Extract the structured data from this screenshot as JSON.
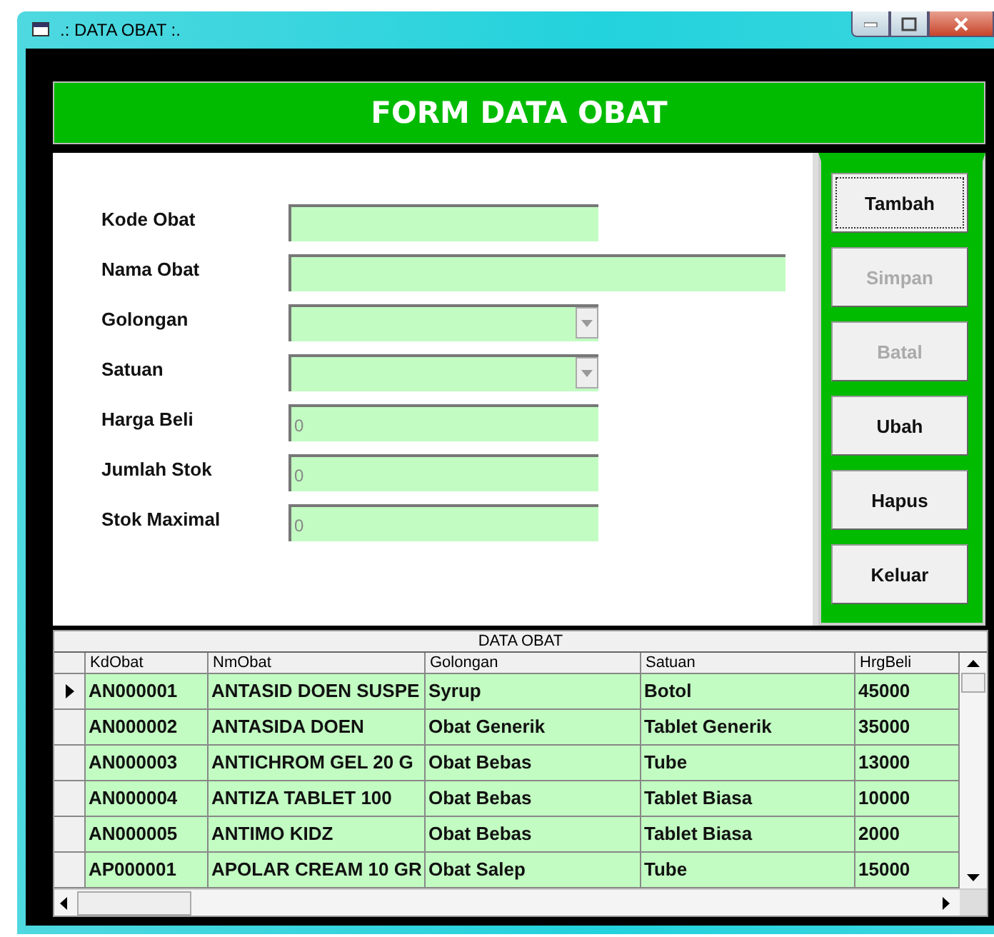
{
  "window": {
    "title": ".: DATA OBAT :."
  },
  "header": {
    "title": "FORM DATA OBAT"
  },
  "fields": [
    {
      "label": "Kode Obat",
      "kind": "text",
      "wide": false
    },
    {
      "label": "Nama Obat",
      "kind": "text",
      "wide": true
    },
    {
      "label": "Golongan",
      "kind": "combo",
      "wide": false
    },
    {
      "label": "Satuan",
      "kind": "combo",
      "wide": false
    },
    {
      "label": "Harga Beli",
      "kind": "text",
      "wide": false,
      "value": "0"
    },
    {
      "label": "Jumlah Stok",
      "kind": "text",
      "wide": false,
      "value": "0"
    },
    {
      "label": "Stok Maximal",
      "kind": "text",
      "wide": false,
      "value": "0"
    }
  ],
  "buttons": [
    {
      "label": "Tambah",
      "disabled": false,
      "focused": true
    },
    {
      "label": "Simpan",
      "disabled": true,
      "focused": false
    },
    {
      "label": "Batal",
      "disabled": true,
      "focused": false
    },
    {
      "label": "Ubah",
      "disabled": false,
      "focused": false
    },
    {
      "label": "Hapus",
      "disabled": false,
      "focused": false
    },
    {
      "label": "Keluar",
      "disabled": false,
      "focused": false
    }
  ],
  "table": {
    "caption": "DATA OBAT",
    "columns": [
      "KdObat",
      "NmObat",
      "Golongan",
      "Satuan",
      "HrgBeli"
    ],
    "rows": [
      {
        "selected": true,
        "cells": [
          "AN000001",
          "ANTASID DOEN SUSPE",
          "Syrup",
          "Botol",
          "45000"
        ]
      },
      {
        "selected": false,
        "cells": [
          "AN000002",
          "ANTASIDA DOEN",
          "Obat Generik",
          "Tablet Generik",
          "35000"
        ]
      },
      {
        "selected": false,
        "cells": [
          "AN000003",
          "ANTICHROM GEL 20 G",
          "Obat Bebas",
          "Tube",
          "13000"
        ]
      },
      {
        "selected": false,
        "cells": [
          "AN000004",
          "ANTIZA TABLET 100",
          "Obat Bebas",
          "Tablet Biasa",
          "10000"
        ]
      },
      {
        "selected": false,
        "cells": [
          "AN000005",
          "ANTIMO KIDZ",
          "Obat Bebas",
          "Tablet Biasa",
          "2000"
        ]
      },
      {
        "selected": false,
        "cells": [
          "AP000001",
          "APOLAR CREAM 10 GR",
          "Obat Salep",
          "Tube",
          "15000"
        ]
      }
    ]
  }
}
